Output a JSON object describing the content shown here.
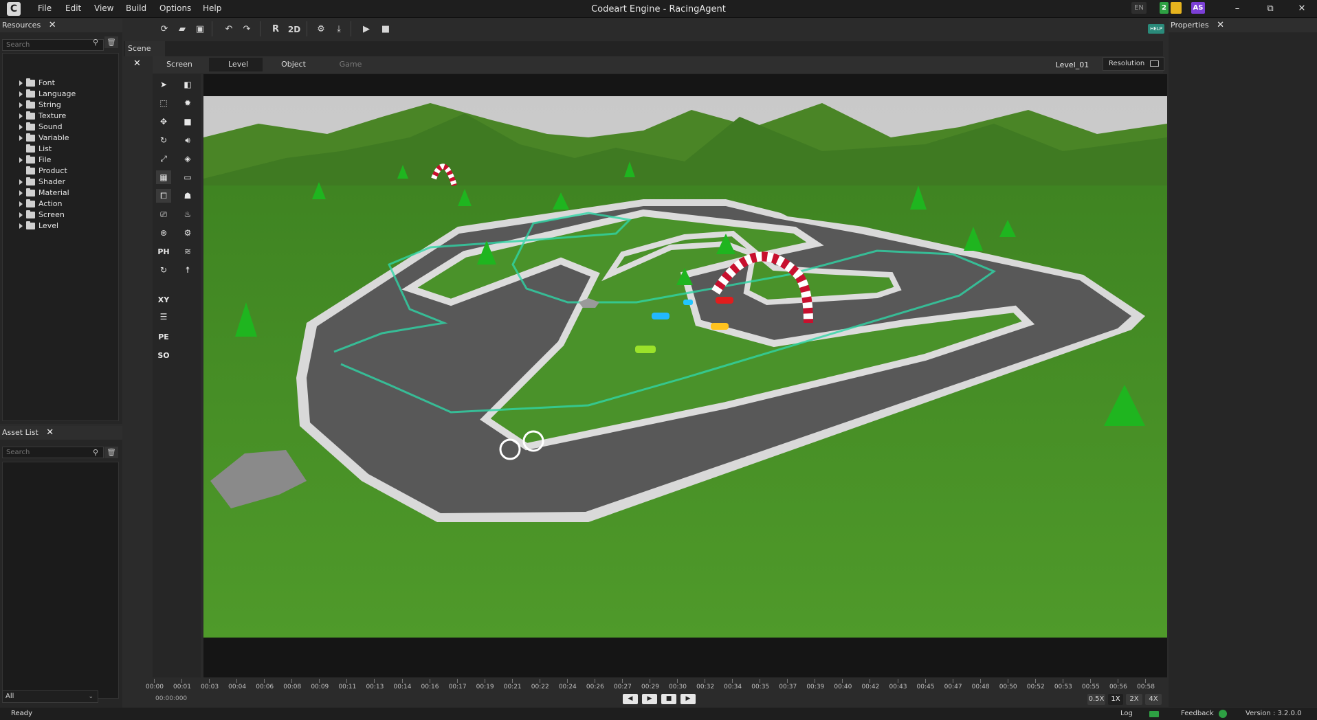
{
  "window": {
    "title": "Codeart Engine - RacingAgent",
    "menu": [
      "File",
      "Edit",
      "View",
      "Build",
      "Options",
      "Help"
    ],
    "lang_badge": "EN",
    "notif_count": "2",
    "user_initials": "AS",
    "minimize_glyph": "–",
    "maximize_glyph": "⧉",
    "close_glyph": "✕"
  },
  "resources": {
    "title": "Resources",
    "search_placeholder": "Search",
    "items": [
      "Font",
      "Language",
      "String",
      "Texture",
      "Sound",
      "Variable",
      "List",
      "File",
      "Product",
      "Shader",
      "Material",
      "Action",
      "Screen",
      "Level"
    ]
  },
  "asset_list": {
    "title": "Asset List",
    "search_placeholder": "Search",
    "filter_value": "All"
  },
  "toolbar": {
    "reset_label": "R",
    "view_2d_label": "2D",
    "help_label": "HELP"
  },
  "scene": {
    "tab_title": "Scene",
    "subtabs": [
      "Screen",
      "Level",
      "Object",
      "Game"
    ],
    "level_name": "Level_01",
    "resolution_label": "Resolution"
  },
  "side_tools": {
    "physics_label": "PH",
    "xy_label": "XY",
    "pe_label": "PE",
    "so_label": "SO"
  },
  "properties": {
    "title": "Properties"
  },
  "timeline": {
    "ticks": [
      "00:00",
      "00:01",
      "00:03",
      "00:04",
      "00:06",
      "00:08",
      "00:09",
      "00:11",
      "00:13",
      "00:14",
      "00:16",
      "00:17",
      "00:19",
      "00:21",
      "00:22",
      "00:24",
      "00:26",
      "00:27",
      "00:29",
      "00:30",
      "00:32",
      "00:34",
      "00:35",
      "00:37",
      "00:39",
      "00:40",
      "00:42",
      "00:43",
      "00:45",
      "00:47",
      "00:48",
      "00:50",
      "00:52",
      "00:53",
      "00:55",
      "00:56",
      "00:58"
    ],
    "current_time": "00:00:000",
    "speeds": [
      "0.5X",
      "1X",
      "2X",
      "4X"
    ],
    "active_speed": "1X"
  },
  "status": {
    "left": "Ready",
    "log_label": "Log",
    "feedback_label": "Feedback",
    "version": "Version : 3.2.0.0"
  },
  "colors": {
    "accent_green": "#2ea043",
    "accent_purple": "#7b3fd6",
    "notif_yellow": "#e6b31e",
    "grass": "#4f9a2a",
    "road": "#5a5a5a"
  }
}
